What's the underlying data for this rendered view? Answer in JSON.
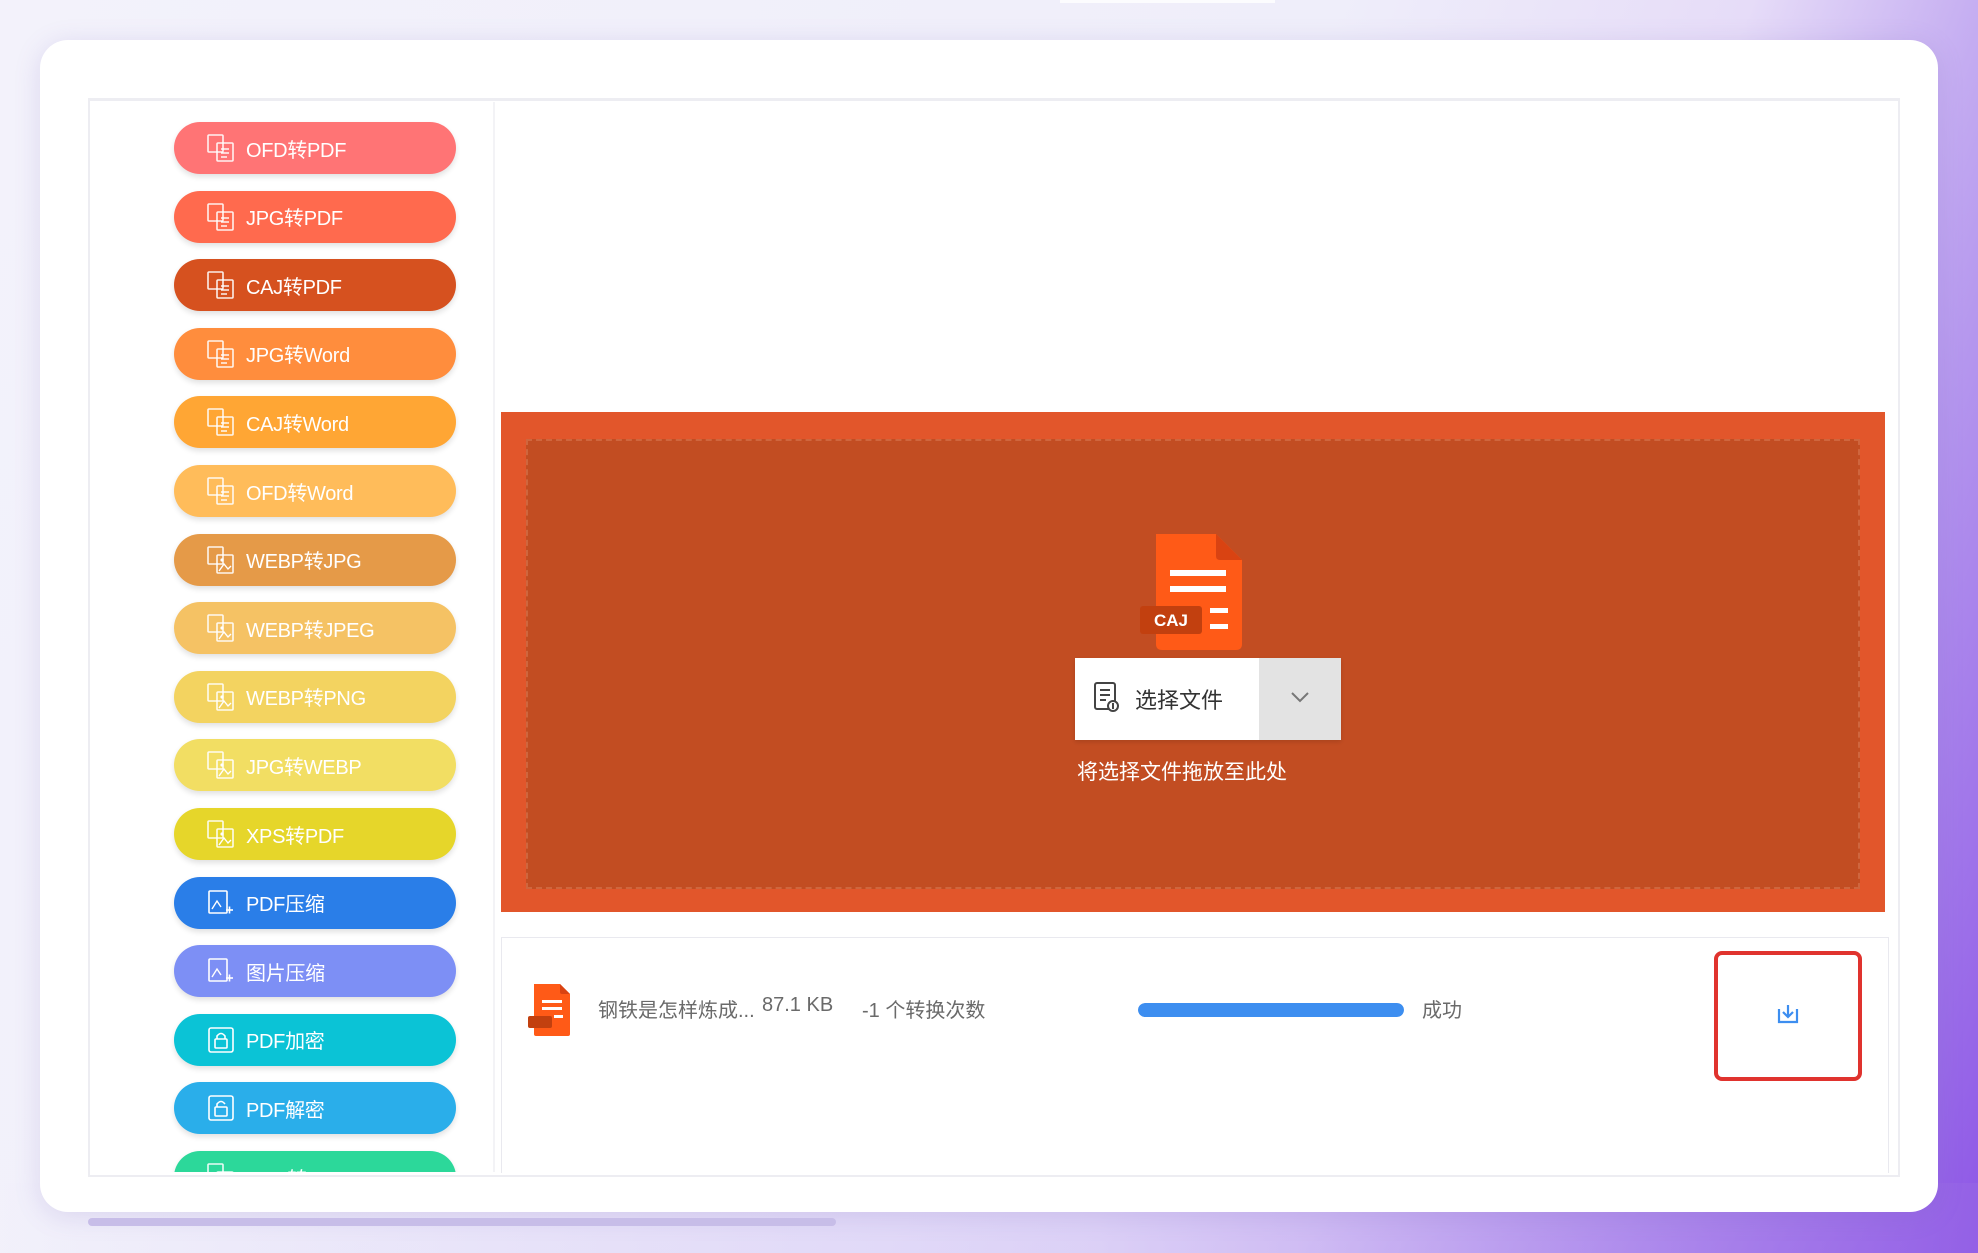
{
  "sidebar": {
    "items": [
      {
        "label": "OFD转PDF",
        "color": "#ff7475",
        "icon": "convert-doc-icon"
      },
      {
        "label": "JPG转PDF",
        "color": "#ff6a4e",
        "icon": "convert-doc-icon"
      },
      {
        "label": "CAJ转PDF",
        "color": "#d6511f",
        "icon": "convert-doc-icon"
      },
      {
        "label": "JPG转Word",
        "color": "#ff8d3d",
        "icon": "convert-doc-icon"
      },
      {
        "label": "CAJ转Word",
        "color": "#ffa634",
        "icon": "convert-doc-icon"
      },
      {
        "label": "OFD转Word",
        "color": "#ffbc5a",
        "icon": "convert-doc-icon"
      },
      {
        "label": "WEBP转JPG",
        "color": "#e59a48",
        "icon": "convert-image-icon"
      },
      {
        "label": "WEBP转JPEG",
        "color": "#f5c264",
        "icon": "convert-image-icon"
      },
      {
        "label": "WEBP转PNG",
        "color": "#f3d360",
        "icon": "convert-image-icon"
      },
      {
        "label": "JPG转WEBP",
        "color": "#f2de63",
        "icon": "convert-image-icon"
      },
      {
        "label": "XPS转PDF",
        "color": "#e6d62a",
        "icon": "convert-image-icon"
      },
      {
        "label": "PDF压缩",
        "color": "#2a7ee8",
        "icon": "compress-icon"
      },
      {
        "label": "图片压缩",
        "color": "#7d8ff5",
        "icon": "compress-icon"
      },
      {
        "label": "PDF加密",
        "color": "#0bc3d6",
        "icon": "lock-icon"
      },
      {
        "label": "PDF解密",
        "color": "#2aaeea",
        "icon": "unlock-icon"
      },
      {
        "label": "CAD转PDF",
        "color": "#2cd89a",
        "icon": "convert-doc-icon"
      }
    ]
  },
  "dropzone": {
    "file_icon_label": "CAJ",
    "select_button_label": "选择文件",
    "hint": "将选择文件拖放至此处",
    "accent": "#e2562b",
    "inner": "#c24d22"
  },
  "file_list": {
    "rows": [
      {
        "name": "钢铁是怎样炼成...",
        "size": "87.1 KB",
        "count": "-1 个转换次数",
        "progress": 1.0,
        "status": "成功",
        "action_icon": "download-icon"
      }
    ]
  }
}
